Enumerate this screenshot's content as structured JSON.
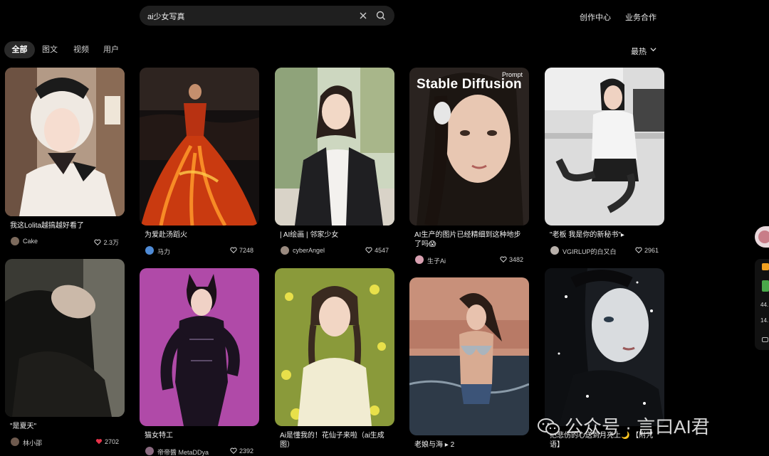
{
  "search": {
    "value": "ai少女写真"
  },
  "header": {
    "nav": [
      "创作中心",
      "业务合作"
    ]
  },
  "tabs": [
    "全部",
    "图文",
    "视频",
    "用户"
  ],
  "sort": {
    "label": "最热"
  },
  "cards": [
    {
      "title": "我这Lolita越搞越好看了",
      "author": "Cake",
      "likes": "2.3万"
    },
    {
      "title": "为爱赴汤蹈火",
      "author": "马力",
      "likes": "7248"
    },
    {
      "title": "| AI绘画 | 邻家少女",
      "author": "cyberAngel",
      "likes": "4547"
    },
    {
      "title": "AI生产的图片已经精细到这种地步了吗😱",
      "author": "生子Ai",
      "likes": "3482",
      "overlay_title": "Stable Diffusion",
      "overlay_tag": "Prompt"
    },
    {
      "title": "\"老板 我是你的新秘书\"▸",
      "author": "VGIRLUP的白又白",
      "likes": "2961"
    },
    {
      "title": "\"是夏天\"",
      "author": "林小邵",
      "likes": "2702",
      "liked": true
    },
    {
      "title": "猫女特工",
      "author": "帝帝醬 MetaDDya",
      "likes": "2392"
    },
    {
      "title": "Ai是懂我的！花仙子来啦（ai生成图）",
      "author": "",
      "likes": ""
    },
    {
      "title": "老娘与海 ▸ 2",
      "author": "",
      "likes": ""
    },
    {
      "title": "把悲伤的心送到月亮上🌙 【附咒语】",
      "author": "",
      "likes": ""
    }
  ],
  "side": {
    "lines": [
      "44.",
      "14."
    ]
  },
  "watermark": {
    "text": "公众号 · 言曰AI君"
  },
  "colors": {
    "background": "#000000",
    "search_bg": "#1f1f1f",
    "active_tab_bg": "#2a2a2a",
    "like_red": "#e8334a"
  }
}
